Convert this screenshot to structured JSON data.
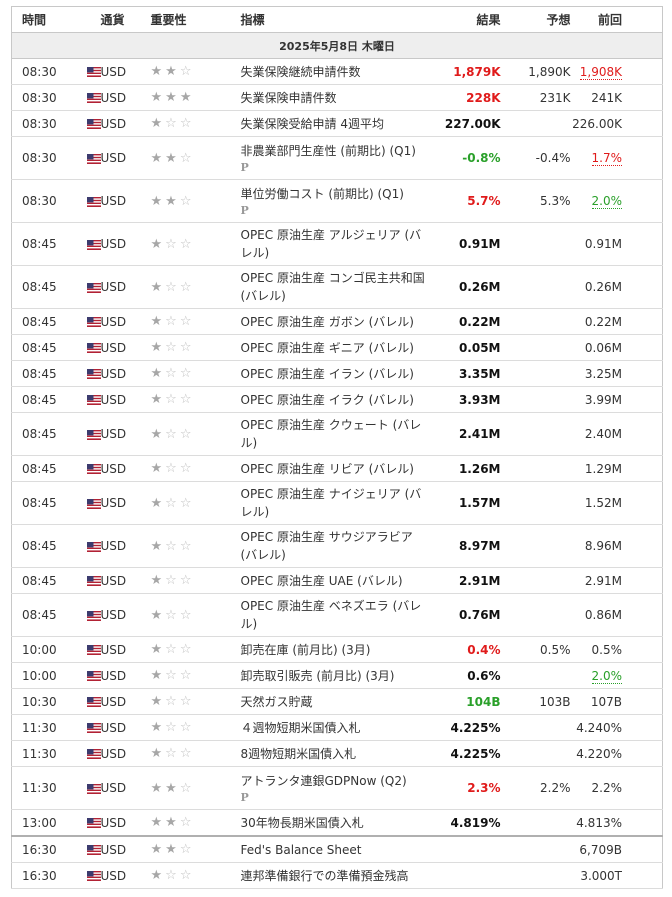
{
  "header": {
    "time": "時間",
    "currency": "通貨",
    "importance": "重要性",
    "indicator": "指標",
    "actual": "結果",
    "forecast": "予想",
    "previous": "前回"
  },
  "date_label": "2025年5月8日 木曜日",
  "colors": {
    "red": "#e01b1b",
    "green": "#2aa02a",
    "star_filled": "#a7a7a7",
    "star_empty": "#c0c0c0"
  },
  "rows": [
    {
      "time": "08:30",
      "currency": "USD",
      "stars": 2,
      "indicator": "失業保険継続申請件数",
      "p": false,
      "actual": "1,879K",
      "actual_color": "red",
      "forecast": "1,890K",
      "previous": "1,908K",
      "previous_style": "u-red"
    },
    {
      "time": "08:30",
      "currency": "USD",
      "stars": 3,
      "indicator": "失業保険申請件数",
      "p": false,
      "actual": "228K",
      "actual_color": "red",
      "forecast": "231K",
      "previous": "241K",
      "previous_style": ""
    },
    {
      "time": "08:30",
      "currency": "USD",
      "stars": 1,
      "indicator": "失業保険受給申請 4週平均",
      "p": false,
      "actual": "227.00K",
      "actual_color": "",
      "forecast": "",
      "previous": "226.00K",
      "previous_style": ""
    },
    {
      "time": "08:30",
      "currency": "USD",
      "stars": 2,
      "indicator": "非農業部門生産性 (前期比) (Q1)",
      "p": true,
      "actual": "-0.8%",
      "actual_color": "green",
      "forecast": "-0.4%",
      "previous": "1.7%",
      "previous_style": "u-red"
    },
    {
      "time": "08:30",
      "currency": "USD",
      "stars": 2,
      "indicator": "単位労働コスト (前期比) (Q1)",
      "p": true,
      "actual": "5.7%",
      "actual_color": "red",
      "forecast": "5.3%",
      "previous": "2.0%",
      "previous_style": "u-green"
    },
    {
      "time": "08:45",
      "currency": "USD",
      "stars": 1,
      "indicator": "OPEC 原油生産 アルジェリア (バレル)",
      "p": false,
      "actual": "0.91M",
      "actual_color": "",
      "forecast": "",
      "previous": "0.91M",
      "previous_style": ""
    },
    {
      "time": "08:45",
      "currency": "USD",
      "stars": 1,
      "indicator": "OPEC 原油生産 コンゴ民主共和国 (バレル)",
      "p": false,
      "actual": "0.26M",
      "actual_color": "",
      "forecast": "",
      "previous": "0.26M",
      "previous_style": ""
    },
    {
      "time": "08:45",
      "currency": "USD",
      "stars": 1,
      "indicator": "OPEC 原油生産 ガボン (バレル)",
      "p": false,
      "actual": "0.22M",
      "actual_color": "",
      "forecast": "",
      "previous": "0.22M",
      "previous_style": ""
    },
    {
      "time": "08:45",
      "currency": "USD",
      "stars": 1,
      "indicator": "OPEC 原油生産 ギニア (バレル)",
      "p": false,
      "actual": "0.05M",
      "actual_color": "",
      "forecast": "",
      "previous": "0.06M",
      "previous_style": ""
    },
    {
      "time": "08:45",
      "currency": "USD",
      "stars": 1,
      "indicator": "OPEC 原油生産 イラン (バレル)",
      "p": false,
      "actual": "3.35M",
      "actual_color": "",
      "forecast": "",
      "previous": "3.25M",
      "previous_style": ""
    },
    {
      "time": "08:45",
      "currency": "USD",
      "stars": 1,
      "indicator": "OPEC 原油生産 イラク (バレル)",
      "p": false,
      "actual": "3.93M",
      "actual_color": "",
      "forecast": "",
      "previous": "3.99M",
      "previous_style": ""
    },
    {
      "time": "08:45",
      "currency": "USD",
      "stars": 1,
      "indicator": "OPEC 原油生産 クウェート (バレル)",
      "p": false,
      "actual": "2.41M",
      "actual_color": "",
      "forecast": "",
      "previous": "2.40M",
      "previous_style": ""
    },
    {
      "time": "08:45",
      "currency": "USD",
      "stars": 1,
      "indicator": "OPEC 原油生産 リビア (バレル)",
      "p": false,
      "actual": "1.26M",
      "actual_color": "",
      "forecast": "",
      "previous": "1.29M",
      "previous_style": ""
    },
    {
      "time": "08:45",
      "currency": "USD",
      "stars": 1,
      "indicator": "OPEC 原油生産 ナイジェリア (バレル)",
      "p": false,
      "actual": "1.57M",
      "actual_color": "",
      "forecast": "",
      "previous": "1.52M",
      "previous_style": ""
    },
    {
      "time": "08:45",
      "currency": "USD",
      "stars": 1,
      "indicator": "OPEC 原油生産 サウジアラビア (バレル)",
      "p": false,
      "actual": "8.97M",
      "actual_color": "",
      "forecast": "",
      "previous": "8.96M",
      "previous_style": ""
    },
    {
      "time": "08:45",
      "currency": "USD",
      "stars": 1,
      "indicator": "OPEC 原油生産 UAE (バレル)",
      "p": false,
      "actual": "2.91M",
      "actual_color": "",
      "forecast": "",
      "previous": "2.91M",
      "previous_style": ""
    },
    {
      "time": "08:45",
      "currency": "USD",
      "stars": 1,
      "indicator": "OPEC 原油生産 ベネズエラ (バレル)",
      "p": false,
      "actual": "0.76M",
      "actual_color": "",
      "forecast": "",
      "previous": "0.86M",
      "previous_style": ""
    },
    {
      "time": "10:00",
      "currency": "USD",
      "stars": 1,
      "indicator": "卸売在庫 (前月比) (3月)",
      "p": false,
      "actual": "0.4%",
      "actual_color": "red",
      "forecast": "0.5%",
      "previous": "0.5%",
      "previous_style": ""
    },
    {
      "time": "10:00",
      "currency": "USD",
      "stars": 1,
      "indicator": "卸売取引販売 (前月比) (3月)",
      "p": false,
      "actual": "0.6%",
      "actual_color": "",
      "forecast": "",
      "previous": "2.0%",
      "previous_style": "u-green"
    },
    {
      "time": "10:30",
      "currency": "USD",
      "stars": 1,
      "indicator": "天然ガス貯蔵",
      "p": false,
      "actual": "104B",
      "actual_color": "green",
      "forecast": "103B",
      "previous": "107B",
      "previous_style": ""
    },
    {
      "time": "11:30",
      "currency": "USD",
      "stars": 1,
      "indicator": "４週物短期米国債入札",
      "p": false,
      "actual": "4.225%",
      "actual_color": "",
      "forecast": "",
      "previous": "4.240%",
      "previous_style": ""
    },
    {
      "time": "11:30",
      "currency": "USD",
      "stars": 1,
      "indicator": "8週物短期米国債入札",
      "p": false,
      "actual": "4.225%",
      "actual_color": "",
      "forecast": "",
      "previous": "4.220%",
      "previous_style": ""
    },
    {
      "time": "11:30",
      "currency": "USD",
      "stars": 2,
      "indicator": "アトランタ連銀GDPNow (Q2)",
      "p": true,
      "actual": "2.3%",
      "actual_color": "red",
      "forecast": "2.2%",
      "previous": "2.2%",
      "previous_style": ""
    },
    {
      "time": "13:00",
      "currency": "USD",
      "stars": 2,
      "indicator": "30年物長期米国債入札",
      "p": false,
      "actual": "4.819%",
      "actual_color": "",
      "forecast": "",
      "previous": "4.813%",
      "previous_style": ""
    },
    {
      "time": "16:30",
      "currency": "USD",
      "stars": 2,
      "indicator": "Fed's Balance Sheet",
      "p": false,
      "actual": "",
      "actual_color": "",
      "forecast": "",
      "previous": "6,709B",
      "previous_style": "",
      "sep": true
    },
    {
      "time": "16:30",
      "currency": "USD",
      "stars": 1,
      "indicator": "連邦準備銀行での準備預金残高",
      "p": false,
      "actual": "",
      "actual_color": "",
      "forecast": "",
      "previous": "3.000T",
      "previous_style": ""
    }
  ]
}
